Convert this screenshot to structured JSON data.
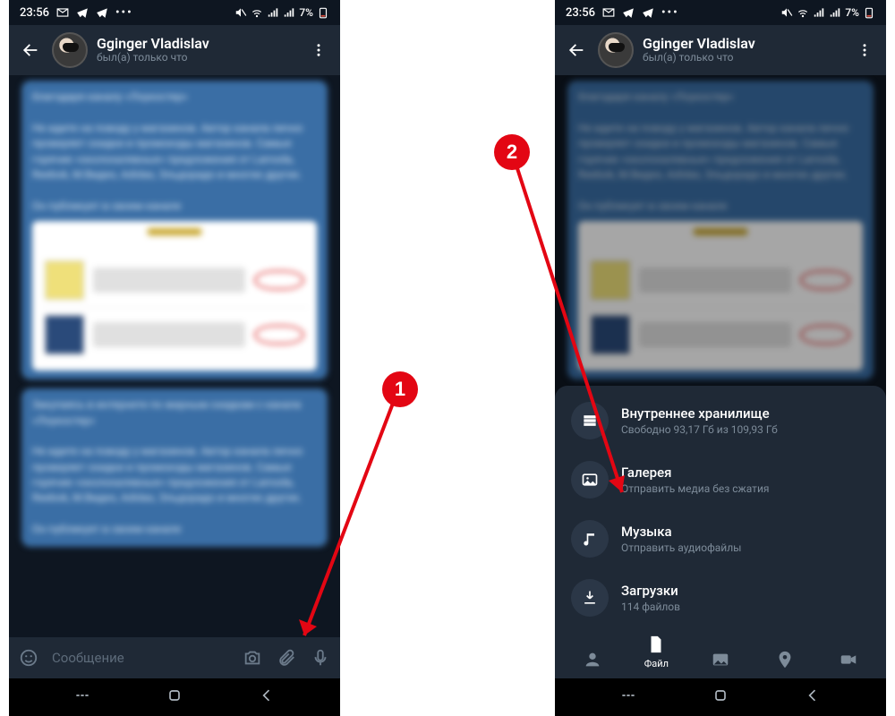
{
  "status": {
    "time": "23:56",
    "battery": "7%"
  },
  "header": {
    "name": "Gginger Vladislav",
    "sub": "был(а) только что"
  },
  "input": {
    "placeholder": "Сообщение"
  },
  "bubble1": {
    "line0": "благодаря каналу «Лоукостер»",
    "body": "Не идите на поводу у магазинов. Автор канала лично проверяет скидки и промокоды магазинов.  Самые горячие «околохалявные» предложения от Lamoda, Reebok, М.Видео, Adidas, Эльдорадо и многих других.",
    "foot": "Он публикует в своем канале"
  },
  "bubble2": {
    "body": "Закупаясь в интернете по жирным скидкам с канала «Лоукостер»\n\nНе идите на поводу у магазинов. Автор канала лично проверяет скидки и промокоды магазинов.  Самые горячие «околохалявные» предложения от Lamoda, Reebok, М.Видео, Adidas, Эльдорадо и многих других.",
    "foot": "Он публикует в своем канале"
  },
  "sheet": {
    "storage": {
      "title": "Внутреннее хранилище",
      "sub": "Свободно 93,17 Гб из 109,93 Гб"
    },
    "gallery": {
      "title": "Галерея",
      "sub": "Отправить медиа без сжатия"
    },
    "music": {
      "title": "Музыка",
      "sub": "Отправить аудиофайлы"
    },
    "downloads": {
      "title": "Загрузки",
      "sub": "114 файлов"
    },
    "tab_file": "Файл"
  },
  "markers": {
    "m1": "1",
    "m2": "2"
  }
}
